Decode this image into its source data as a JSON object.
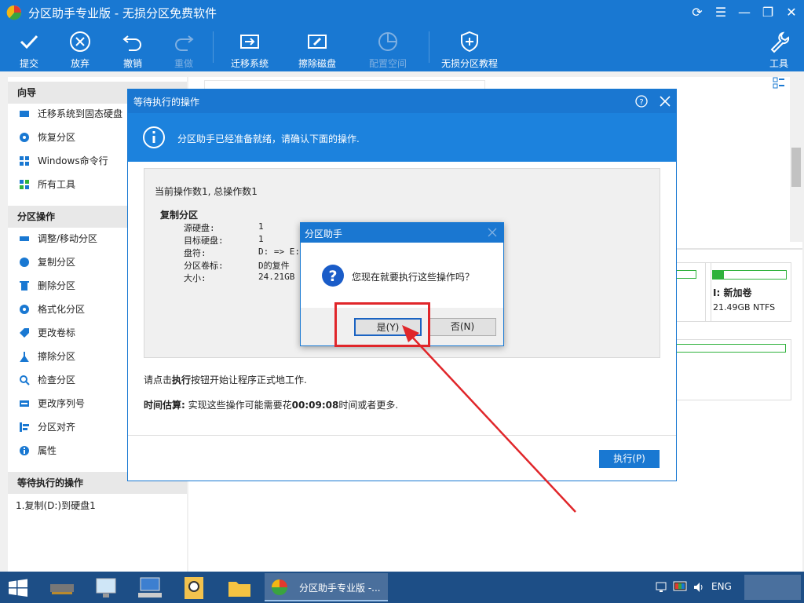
{
  "app": {
    "title": "分区助手专业版 - 无损分区免费软件"
  },
  "toolbar": {
    "commit": "提交",
    "discard": "放弃",
    "undo": "撤销",
    "redo": "重做",
    "migrate": "迁移系统",
    "wipe": "擦除磁盘",
    "allocate": "配置空间",
    "tutorial": "无损分区教程",
    "tools": "工具"
  },
  "sidebar": {
    "wizard_title": "向导",
    "wizard": [
      "迁移系统到固态硬盘",
      "恢复分区",
      "Windows命令行",
      "所有工具"
    ],
    "ops_title": "分区操作",
    "ops": [
      "调整/移动分区",
      "复制分区",
      "删除分区",
      "格式化分区",
      "更改卷标",
      "擦除分区",
      "检查分区",
      "更改序列号",
      "分区对齐",
      "属性"
    ],
    "pending_title": "等待执行的操作",
    "pending": [
      "1.复制(D:)到硬盘1"
    ]
  },
  "disk": {
    "label": "I: 新加卷",
    "info": "21.49GB NTFS"
  },
  "dialog": {
    "title": "等待执行的操作",
    "banner": "分区助手已经准备就绪，请确认下面的操作.",
    "count": "当前操作数1, 总操作数1",
    "op_title": "复制分区",
    "rows": [
      {
        "k": "源硬盘:",
        "v": "1"
      },
      {
        "k": "目标硬盘:",
        "v": "1"
      },
      {
        "k": "盘符:",
        "v": "D: => E:"
      },
      {
        "k": "分区卷标:",
        "v": "D的复件"
      },
      {
        "k": "大小:",
        "v": "24.21GB ="
      }
    ],
    "hint_pre": "请点击",
    "hint_bold": "执行",
    "hint_post": "按钮开始让程序正式地工作.",
    "est_label": "时间估算:",
    "est_pre": " 实现这些操作可能需要花",
    "est_time": "00:09:08",
    "est_post": "时间或者更多.",
    "execute": "执行(P)"
  },
  "confirm": {
    "title": "分区助手",
    "message": "您现在就要执行这些操作吗？",
    "yes": "是(Y)",
    "no": "否(N)"
  },
  "taskbar": {
    "active": "分区助手专业版 -...",
    "lang": "ENG"
  },
  "colors": {
    "accent": "#1978d2",
    "highlight": "#e0262a",
    "progress": "#2fb23c"
  }
}
